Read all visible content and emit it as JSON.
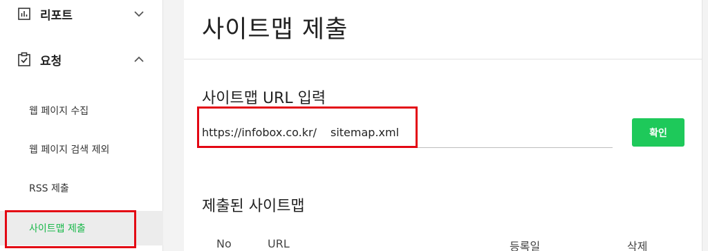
{
  "sidebar": {
    "report": {
      "label": "리포트",
      "icon": "bar-chart-icon",
      "chevron": "chevron-down-icon"
    },
    "request": {
      "label": "요청",
      "icon": "clipboard-check-icon",
      "chevron": "chevron-up-icon"
    },
    "items": [
      {
        "label": "웹 페이지 수집",
        "active": false
      },
      {
        "label": "웹 페이지 검색 제외",
        "active": false
      },
      {
        "label": "RSS 제출",
        "active": false
      },
      {
        "label": "사이트맵 제출",
        "active": true
      }
    ]
  },
  "page": {
    "title": "사이트맵 제출"
  },
  "form": {
    "section_title": "사이트맵 URL 입력",
    "url_prefix": "https://infobox.co.kr/",
    "url_value": "sitemap.xml",
    "confirm_label": "확인"
  },
  "submitted": {
    "section_title": "제출된 사이트맵",
    "columns": [
      "No",
      "URL",
      "등록일",
      "삭제"
    ]
  },
  "colors": {
    "accent_green": "#1ec95a",
    "active_text_green": "#19b84a",
    "highlight_red": "#e30613"
  }
}
